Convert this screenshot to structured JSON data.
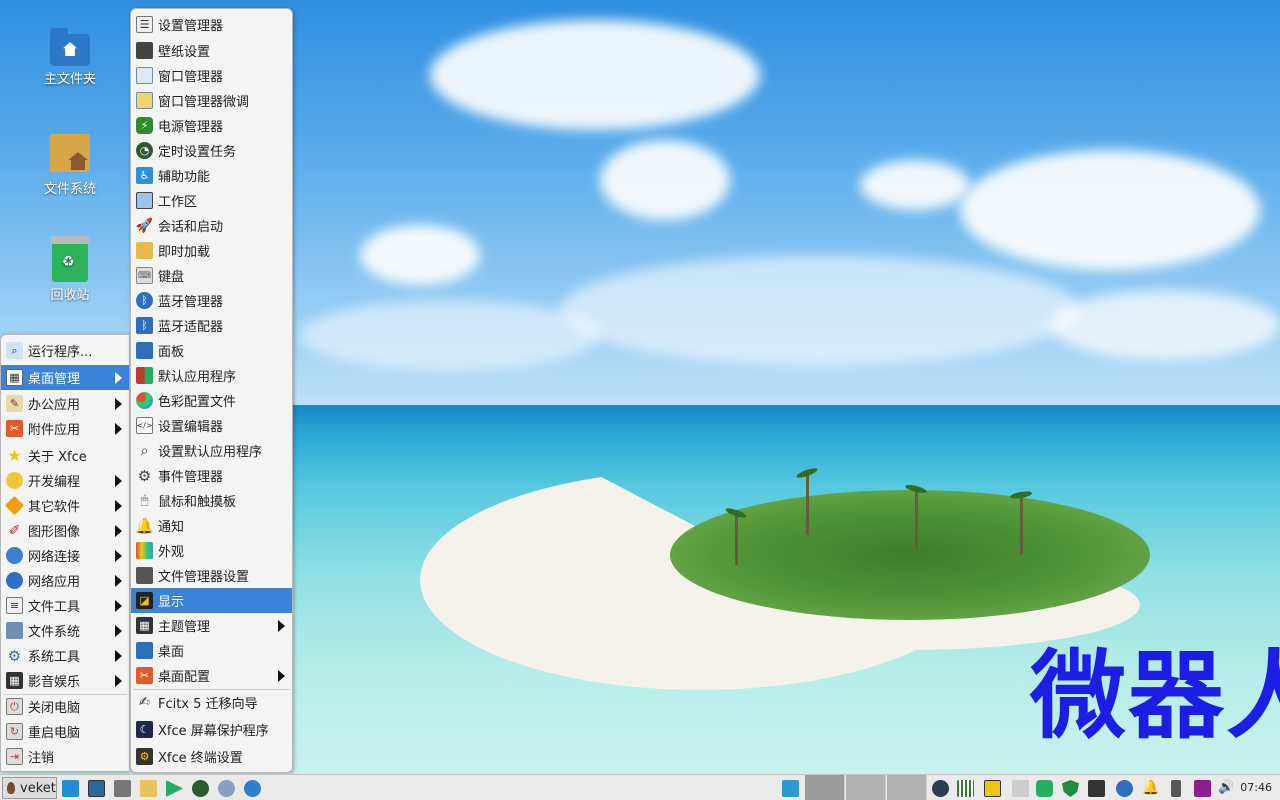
{
  "desktop": {
    "icons": [
      {
        "label": "主文件夹"
      },
      {
        "label": "文件系统"
      },
      {
        "label": "回收站"
      }
    ],
    "watermark": "微器人"
  },
  "main_menu": {
    "items": [
      {
        "label": "运行程序...",
        "icon": "search-icon",
        "submenu": false
      },
      {
        "label": "桌面管理",
        "icon": "desktop-settings-icon",
        "submenu": true,
        "active": true
      },
      {
        "label": "办公应用",
        "icon": "office-icon",
        "submenu": true
      },
      {
        "label": "附件应用",
        "icon": "accessories-icon",
        "submenu": true
      },
      {
        "label": "关于 Xfce",
        "icon": "star-icon",
        "submenu": false
      },
      {
        "label": "开发编程",
        "icon": "development-icon",
        "submenu": true
      },
      {
        "label": "其它软件",
        "icon": "other-icon",
        "submenu": true
      },
      {
        "label": "图形图像",
        "icon": "graphics-icon",
        "submenu": true
      },
      {
        "label": "网络连接",
        "icon": "network-icon",
        "submenu": true
      },
      {
        "label": "网络应用",
        "icon": "internet-icon",
        "submenu": true
      },
      {
        "label": "文件工具",
        "icon": "file-tools-icon",
        "submenu": true
      },
      {
        "label": "文件系统",
        "icon": "folder-icon",
        "submenu": true
      },
      {
        "label": "系统工具",
        "icon": "gear-icon",
        "submenu": true
      },
      {
        "label": "影音娱乐",
        "icon": "media-icon",
        "submenu": true
      },
      {
        "label": "关闭电脑",
        "icon": "shutdown-icon",
        "submenu": false
      },
      {
        "label": "重启电脑",
        "icon": "reboot-icon",
        "submenu": false
      },
      {
        "label": "注销",
        "icon": "logout-icon",
        "submenu": false
      }
    ]
  },
  "sub_menu": {
    "items": [
      {
        "label": "设置管理器",
        "icon": "settings-manager-icon"
      },
      {
        "label": "壁纸设置",
        "icon": "wallpaper-icon"
      },
      {
        "label": "窗口管理器",
        "icon": "window-manager-icon"
      },
      {
        "label": "窗口管理器微调",
        "icon": "window-tweaks-icon"
      },
      {
        "label": "电源管理器",
        "icon": "battery-icon"
      },
      {
        "label": "定时设置任务",
        "icon": "clock-icon"
      },
      {
        "label": "辅助功能",
        "icon": "accessibility-icon"
      },
      {
        "label": "工作区",
        "icon": "workspace-icon"
      },
      {
        "label": "会话和启动",
        "icon": "rocket-icon"
      },
      {
        "label": "即时加载",
        "icon": "preload-icon"
      },
      {
        "label": "键盘",
        "icon": "keyboard-icon"
      },
      {
        "label": "蓝牙管理器",
        "icon": "bluetooth-icon"
      },
      {
        "label": "蓝牙适配器",
        "icon": "bluetooth-adapter-icon"
      },
      {
        "label": "面板",
        "icon": "panel-icon"
      },
      {
        "label": "默认应用程序",
        "icon": "default-apps-icon"
      },
      {
        "label": "色彩配置文件",
        "icon": "color-profile-icon"
      },
      {
        "label": "设置编辑器",
        "icon": "code-icon"
      },
      {
        "label": "设置默认应用程序",
        "icon": "search-default-icon"
      },
      {
        "label": "事件管理器",
        "icon": "gear-icon"
      },
      {
        "label": "鼠标和触摸板",
        "icon": "mouse-icon"
      },
      {
        "label": "通知",
        "icon": "bell-icon"
      },
      {
        "label": "外观",
        "icon": "appearance-icon"
      },
      {
        "label": "文件管理器设置",
        "icon": "file-manager-icon"
      },
      {
        "label": "显示",
        "icon": "display-icon",
        "active": true
      },
      {
        "label": "主题管理",
        "icon": "theme-icon",
        "submenu": true
      },
      {
        "label": "桌面",
        "icon": "desktop-icon"
      },
      {
        "label": "桌面配置",
        "icon": "desktop-config-icon",
        "submenu": true
      },
      {
        "label": "Fcitx 5 迁移向导",
        "icon": "fcitx-icon"
      },
      {
        "label": "Xfce 屏幕保护程序",
        "icon": "screensaver-icon"
      },
      {
        "label": "Xfce 终端设置",
        "icon": "terminal-settings-icon"
      }
    ]
  },
  "taskbar": {
    "start_label": "veket",
    "clock": "07:46"
  },
  "colors": {
    "accent": "#3b82d8",
    "watermark": "#1c1ee6"
  }
}
